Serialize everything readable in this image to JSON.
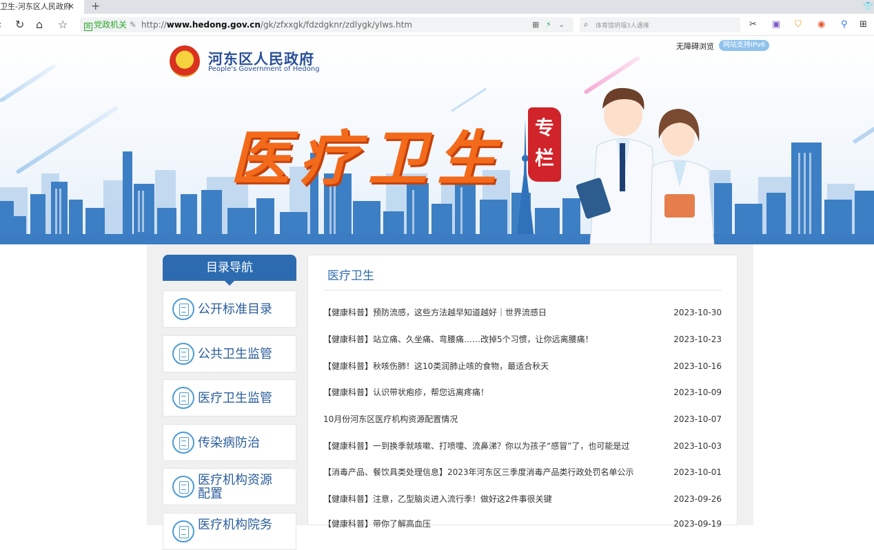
{
  "browser": {
    "tab_title": "卫生-河东区人民政府",
    "tab_close": "×",
    "new_tab": "+",
    "cert_label": "党政机关",
    "url_prefix": "http://",
    "url_domain": "www.hedong.gov.cn",
    "url_path": "/gk/zfxxgk/fdzdgknr/zdlygk/ylws.htm",
    "search_placeholder": "体育馆坍塌3人遇难"
  },
  "header": {
    "site_name": "河东区人民政府",
    "site_name_en": "People's Government of Hedong",
    "accessibility_link": "无障碍浏览",
    "ipv6_badge": "网站支持IPv6",
    "banner_title": "医疗卫生",
    "banner_seal": "专栏"
  },
  "sidebar": {
    "heading": "目录导航",
    "items": [
      {
        "label": "公开标准目录"
      },
      {
        "label": "公共卫生监管"
      },
      {
        "label": "医疗卫生监管"
      },
      {
        "label": "传染病防治"
      },
      {
        "label": "医疗机构资源配置"
      },
      {
        "label": "医疗机构院务"
      }
    ]
  },
  "main": {
    "title": "医疗卫生",
    "articles": [
      {
        "title": "【健康科普】预防流感，这些方法越早知道越好｜世界流感日",
        "date": "2023-10-30"
      },
      {
        "title": "【健康科普】站立痛、久坐痛、弯腰痛……改掉5个习惯，让你远离腰痛！",
        "date": "2023-10-23"
      },
      {
        "title": "【健康科普】秋咳伤肺！这10类润肺止咳的食物，最适合秋天",
        "date": "2023-10-16"
      },
      {
        "title": "【健康科普】认识带状疱疹，帮您远离疼痛！",
        "date": "2023-10-09"
      },
      {
        "title": "10月份河东区医疗机构资源配置情况",
        "date": "2023-10-07"
      },
      {
        "title": "【健康科普】一到换季就咳嗽、打喷嚏、流鼻涕？你以为孩子“感冒”了，也可能是过",
        "date": "2023-10-03"
      },
      {
        "title": "【消毒产品、餐饮具类处理信息】2023年河东区三季度消毒产品类行政处罚名单公示",
        "date": "2023-10-01"
      },
      {
        "title": "【健康科普】注意，乙型脑炎进入流行季！做好这2件事很关键",
        "date": "2023-09-26"
      },
      {
        "title": "【健康科普】带你了解高血压",
        "date": "2023-09-19"
      }
    ]
  }
}
